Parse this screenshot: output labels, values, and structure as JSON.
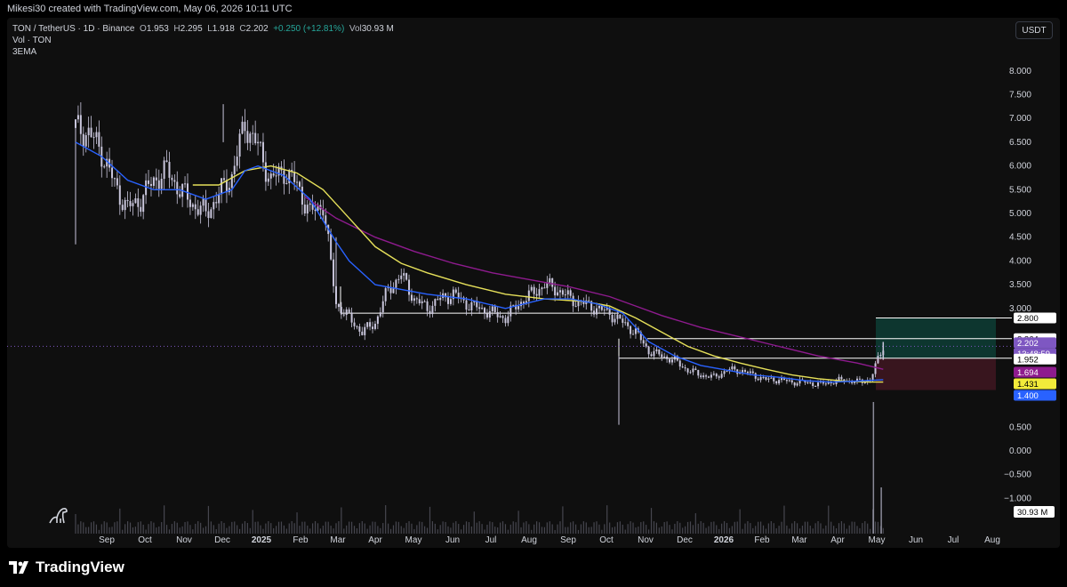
{
  "header": {
    "caption": "Mikesi30 created with TradingView.com, May 06, 2026 10:11 UTC"
  },
  "legend": {
    "symbol": "TON / TetherUS · 1D · Binance",
    "o_label": "O",
    "o_value": "1.953",
    "h_label": "H",
    "h_value": "2.295",
    "l_label": "L",
    "l_value": "1.918",
    "c_label": "C",
    "c_value": "2.202",
    "change": "+0.250 (+12.81%)",
    "vol_label": "Vol",
    "vol_value": "30.93 M",
    "line2": "Vol · TON",
    "line3": "3EMA"
  },
  "currency": "USDT",
  "footer": {
    "brand": "TradingView"
  },
  "colors": {
    "ema_fast": "#2962ff",
    "ema_mid": "#e6e05a",
    "ema_slow": "#8e1b8e",
    "candle": "#c9c6dc",
    "long_profit": "#0d3b33",
    "long_loss": "#3d1620",
    "last_price": "#7e57c2",
    "level": "#ffffff"
  },
  "chart_data": {
    "type": "candlestick",
    "y_axis_labels": [
      "8.000",
      "7.500",
      "7.000",
      "6.500",
      "6.000",
      "5.500",
      "5.000",
      "4.500",
      "4.000",
      "3.500",
      "3.000",
      "0.500",
      "0.000",
      "−0.500",
      "−1.000"
    ],
    "x_axis_labels": [
      "Sep",
      "Oct",
      "Nov",
      "Dec",
      "2025",
      "Feb",
      "Mar",
      "Apr",
      "May",
      "Jun",
      "Jul",
      "Aug",
      "Sep",
      "Oct",
      "Nov",
      "Dec",
      "2026",
      "Feb",
      "Mar",
      "Apr",
      "May",
      "Jun",
      "Jul",
      "Aug"
    ],
    "bold_x_labels": [
      "2025",
      "2026"
    ],
    "price_tags": [
      {
        "name": "level-2800",
        "value": "2.800",
        "bg": "#ffffff",
        "fg": "#000000"
      },
      {
        "name": "level-2364",
        "value": "2.364",
        "bg": "#ffffff",
        "fg": "#000000"
      },
      {
        "name": "last-price",
        "value": "2.202",
        "bg": "#7e57c2",
        "fg": "#ffffff"
      },
      {
        "name": "countdown",
        "value": "13:48:59",
        "bg": "#7e57c2",
        "fg": "#ffffff"
      },
      {
        "name": "level-1952",
        "value": "1.952",
        "bg": "#ffffff",
        "fg": "#000000"
      },
      {
        "name": "ema-slow-value",
        "value": "1.694",
        "bg": "#8e1b8e",
        "fg": "#ffffff"
      },
      {
        "name": "ema-mid-value",
        "value": "1.431",
        "bg": "#f2eb3a",
        "fg": "#000000"
      },
      {
        "name": "ema-fast-value",
        "value": "1.400",
        "bg": "#2962ff",
        "fg": "#ffffff"
      }
    ],
    "volume_tag": "30.93 M",
    "horizontal_levels": [
      2.8,
      2.364,
      1.952,
      2.9,
      2.2
    ],
    "long_position": {
      "entry": 1.952,
      "target": 2.8,
      "stop": 1.694
    },
    "close_path": [
      [
        0,
        6.8
      ],
      [
        5,
        6.7
      ],
      [
        10,
        6.3
      ],
      [
        15,
        5.6
      ],
      [
        20,
        5.1
      ],
      [
        25,
        5.3
      ],
      [
        30,
        5.7
      ],
      [
        35,
        5.9
      ],
      [
        40,
        5.5
      ],
      [
        45,
        5.2
      ],
      [
        50,
        5.0
      ],
      [
        55,
        5.4
      ],
      [
        60,
        5.8
      ],
      [
        65,
        6.9
      ],
      [
        70,
        6.4
      ],
      [
        75,
        5.7
      ],
      [
        80,
        5.9
      ],
      [
        85,
        5.6
      ],
      [
        90,
        5.0
      ],
      [
        95,
        5.2
      ],
      [
        100,
        3.1
      ],
      [
        105,
        2.8
      ],
      [
        110,
        2.5
      ],
      [
        115,
        2.7
      ],
      [
        120,
        3.4
      ],
      [
        125,
        3.7
      ],
      [
        130,
        3.2
      ],
      [
        135,
        3.0
      ],
      [
        140,
        3.2
      ],
      [
        145,
        3.3
      ],
      [
        150,
        3.1
      ],
      [
        155,
        3.0
      ],
      [
        160,
        2.9
      ],
      [
        165,
        2.8
      ],
      [
        170,
        3.1
      ],
      [
        175,
        3.3
      ],
      [
        180,
        3.5
      ],
      [
        185,
        3.4
      ],
      [
        190,
        3.2
      ],
      [
        195,
        3.1
      ],
      [
        200,
        3.0
      ],
      [
        205,
        2.9
      ],
      [
        210,
        2.7
      ],
      [
        215,
        2.5
      ],
      [
        220,
        2.1
      ],
      [
        225,
        2.0
      ],
      [
        230,
        1.9
      ],
      [
        235,
        1.7
      ],
      [
        240,
        1.6
      ],
      [
        245,
        1.55
      ],
      [
        250,
        1.7
      ],
      [
        255,
        1.7
      ],
      [
        260,
        1.6
      ],
      [
        265,
        1.5
      ],
      [
        270,
        1.5
      ],
      [
        275,
        1.45
      ],
      [
        280,
        1.45
      ],
      [
        285,
        1.4
      ],
      [
        290,
        1.45
      ],
      [
        295,
        1.5
      ],
      [
        300,
        1.45
      ],
      [
        305,
        1.5
      ],
      [
        310,
        2.2
      ]
    ],
    "ema_fast_path": [
      [
        0,
        6.5
      ],
      [
        10,
        6.2
      ],
      [
        20,
        5.7
      ],
      [
        30,
        5.5
      ],
      [
        40,
        5.5
      ],
      [
        50,
        5.3
      ],
      [
        60,
        5.5
      ],
      [
        65,
        5.9
      ],
      [
        70,
        6.0
      ],
      [
        80,
        5.8
      ],
      [
        90,
        5.3
      ],
      [
        100,
        4.4
      ],
      [
        105,
        4.0
      ],
      [
        115,
        3.5
      ],
      [
        125,
        3.4
      ],
      [
        135,
        3.3
      ],
      [
        150,
        3.2
      ],
      [
        165,
        3.0
      ],
      [
        180,
        3.2
      ],
      [
        190,
        3.2
      ],
      [
        200,
        3.1
      ],
      [
        210,
        2.9
      ],
      [
        215,
        2.6
      ],
      [
        220,
        2.3
      ],
      [
        230,
        2.0
      ],
      [
        240,
        1.8
      ],
      [
        250,
        1.7
      ],
      [
        260,
        1.6
      ],
      [
        270,
        1.55
      ],
      [
        280,
        1.48
      ],
      [
        290,
        1.45
      ],
      [
        300,
        1.47
      ],
      [
        310,
        1.5
      ]
    ],
    "ema_mid_path": [
      [
        45,
        5.6
      ],
      [
        55,
        5.6
      ],
      [
        65,
        5.9
      ],
      [
        75,
        6.0
      ],
      [
        85,
        5.85
      ],
      [
        95,
        5.5
      ],
      [
        105,
        4.9
      ],
      [
        115,
        4.3
      ],
      [
        125,
        3.95
      ],
      [
        135,
        3.75
      ],
      [
        150,
        3.5
      ],
      [
        165,
        3.3
      ],
      [
        180,
        3.2
      ],
      [
        195,
        3.15
      ],
      [
        205,
        3.05
      ],
      [
        215,
        2.8
      ],
      [
        225,
        2.5
      ],
      [
        235,
        2.2
      ],
      [
        245,
        2.0
      ],
      [
        255,
        1.85
      ],
      [
        265,
        1.72
      ],
      [
        275,
        1.6
      ],
      [
        285,
        1.52
      ],
      [
        295,
        1.47
      ],
      [
        305,
        1.45
      ],
      [
        310,
        1.45
      ]
    ],
    "ema_slow_path": [
      [
        88,
        5.35
      ],
      [
        100,
        4.9
      ],
      [
        115,
        4.5
      ],
      [
        130,
        4.2
      ],
      [
        145,
        3.95
      ],
      [
        160,
        3.75
      ],
      [
        175,
        3.6
      ],
      [
        190,
        3.45
      ],
      [
        205,
        3.25
      ],
      [
        215,
        3.05
      ],
      [
        225,
        2.85
      ],
      [
        240,
        2.6
      ],
      [
        255,
        2.4
      ],
      [
        270,
        2.2
      ],
      [
        285,
        2.0
      ],
      [
        300,
        1.85
      ],
      [
        310,
        1.72
      ]
    ]
  }
}
